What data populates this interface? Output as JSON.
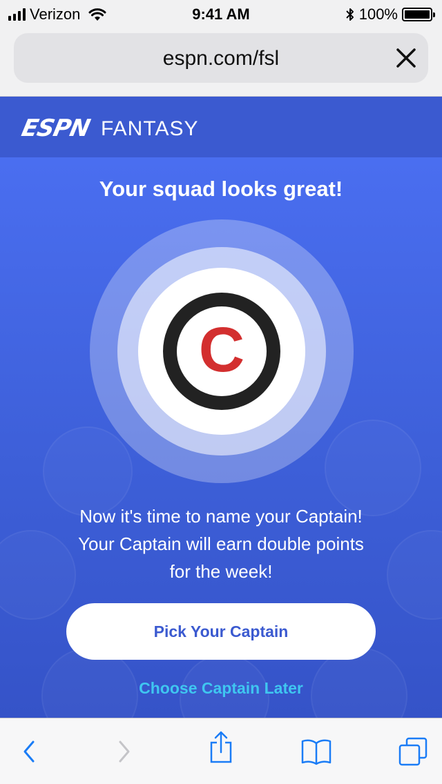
{
  "status_bar": {
    "carrier": "Verizon",
    "time": "9:41 AM",
    "battery": "100%",
    "battery_level": 1.0
  },
  "browser": {
    "url": "espn.com/fsl"
  },
  "header": {
    "logo": "ESPN",
    "product": "FANTASY"
  },
  "main": {
    "headline": "Your squad looks great!",
    "badge_letter": "C",
    "message_lines": [
      "Now it's time to name your Captain!",
      "Your Captain will earn double points",
      "for the week!"
    ],
    "primary_button": "Pick Your Captain",
    "secondary_link": "Choose Captain Later"
  },
  "colors": {
    "brand_blue": "#3b5ad0",
    "captain_red": "#d32f2f",
    "link_cyan": "#3fc6f0",
    "ios_blue": "#1a7cf6"
  },
  "icons": {
    "back": "chevron-left-icon",
    "forward": "chevron-right-icon",
    "share": "share-icon",
    "bookmarks": "book-icon",
    "tabs": "tabs-icon",
    "close": "close-icon"
  }
}
